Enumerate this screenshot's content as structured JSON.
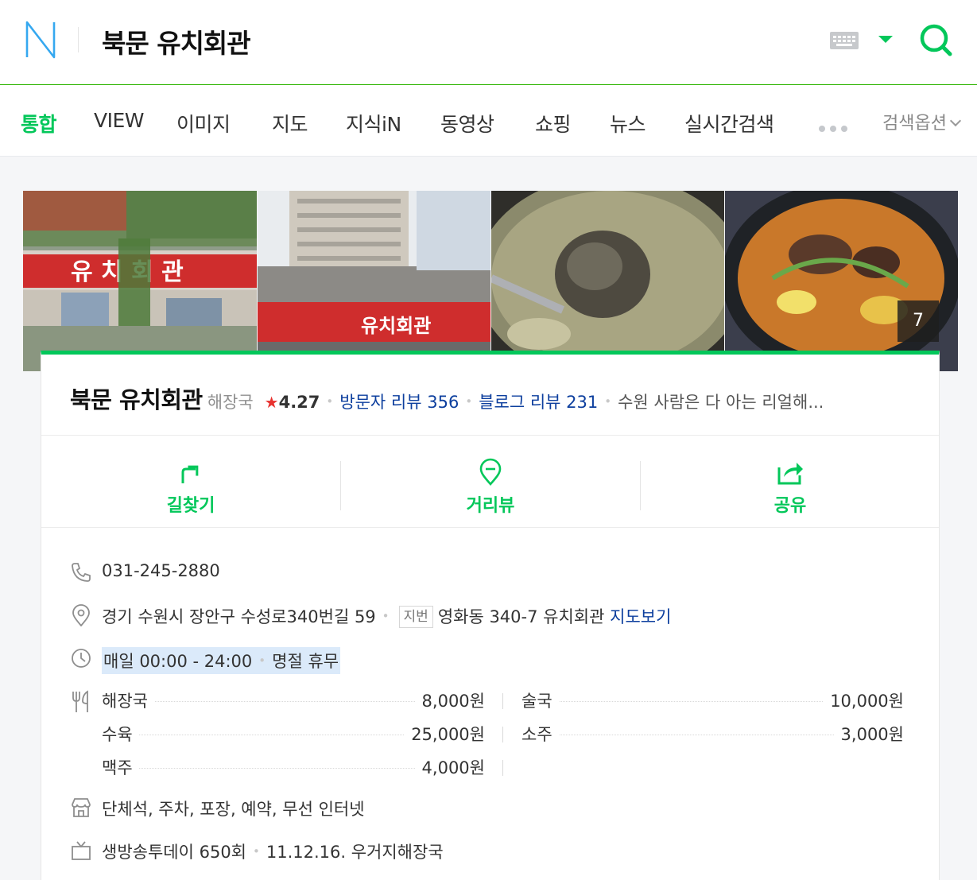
{
  "header": {
    "query": "북문 유치회관",
    "logo_icon": "naver-n-logo-icon",
    "keyboard_icon": "keyboard-icon",
    "dropdown_icon": "caret-down-icon",
    "search_icon": "search-icon",
    "accent_color": "#03c75a"
  },
  "tabs": [
    {
      "label": "통합",
      "active": true
    },
    {
      "label": "VIEW"
    },
    {
      "label": "이미지"
    },
    {
      "label": "지도"
    },
    {
      "label": "지식iN"
    },
    {
      "label": "동영상"
    },
    {
      "label": "쇼핑"
    },
    {
      "label": "뉴스"
    },
    {
      "label": "실시간검색"
    }
  ],
  "search_options": "검색옵션",
  "photos": {
    "more_count": "7"
  },
  "place": {
    "name": "북문 유치회관",
    "category": "해장국",
    "rating": "4.27",
    "visitor_reviews": "방문자 리뷰 356",
    "blog_reviews": "블로그 리뷰 231",
    "description": "수원 사람은 다 아는 리얼해..."
  },
  "actions": [
    {
      "label": "길찾기",
      "icon": "directions-icon"
    },
    {
      "label": "거리뷰",
      "icon": "street-view-icon"
    },
    {
      "label": "공유",
      "icon": "share-icon"
    }
  ],
  "info": {
    "phone": "031-245-2880",
    "address": "경기 수원시 장안구 수성로340번길 59",
    "jibun_badge": "지번",
    "jibun_address": "영화동 340-7 유치회관",
    "map_link": "지도보기",
    "hours": "매일 00:00 - 24:00",
    "holiday": "명절 휴무",
    "amenities": "단체석, 주차, 포장, 예약, 무선 인터넷",
    "tv_show": "생방송투데이 650회",
    "tv_detail": "11.12.16. 우거지해장국"
  },
  "menu": [
    {
      "name": "해장국",
      "price": "8,000원"
    },
    {
      "name": "술국",
      "price": "10,000원"
    },
    {
      "name": "수육",
      "price": "25,000원"
    },
    {
      "name": "소주",
      "price": "3,000원"
    },
    {
      "name": "맥주",
      "price": "4,000원"
    }
  ]
}
